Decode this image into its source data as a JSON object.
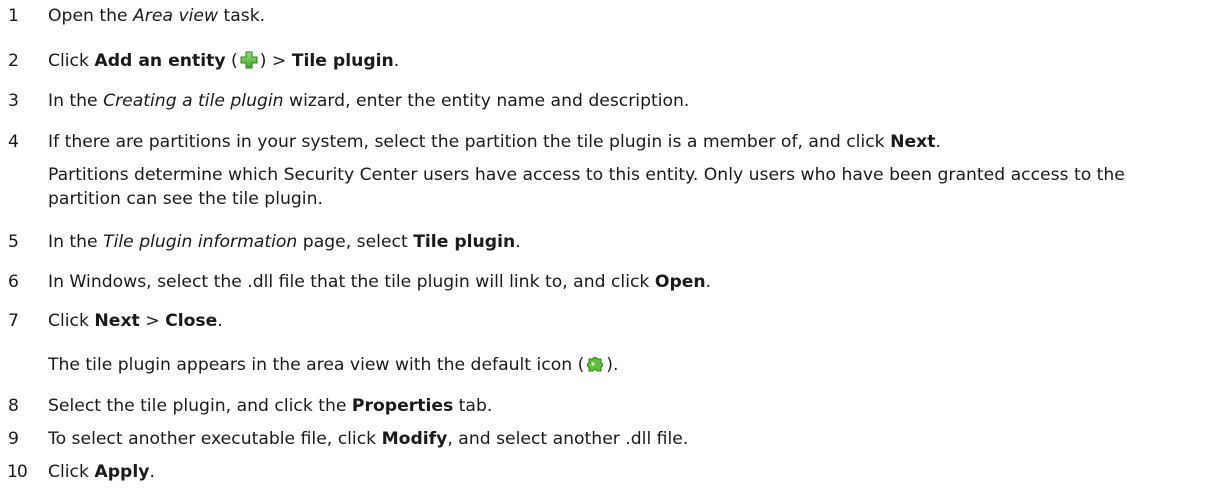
{
  "steps": [
    {
      "num": "1",
      "a": "Open the ",
      "b_italic": "Area view",
      "c": " task."
    },
    {
      "num": "2",
      "a": "Click ",
      "b_bold": "Add an entity",
      "c": " (",
      "icon": "add-entity-icon",
      "d": ") > ",
      "e_bold": "Tile plugin",
      "f": "."
    },
    {
      "num": "3",
      "a": "In the ",
      "b_italic": "Creating a tile plugin",
      "c": " wizard, enter the entity name and description."
    },
    {
      "num": "4",
      "a": "If there are partitions in your system, select the partition the tile plugin is a member of, and click ",
      "b_bold": "Next",
      "c": ".",
      "note": "Partitions determine which Security Center users have access to this entity. Only users who have been granted access to the partition can see the tile plugin."
    },
    {
      "num": "5",
      "a": "In the ",
      "b_italic": "Tile plugin information",
      "c": " page, select ",
      "d_bold": "Tile plugin",
      "e": "."
    },
    {
      "num": "6",
      "a": "In Windows, select the .dll file that the tile plugin will link to, and click ",
      "b_bold": "Open",
      "c": "."
    },
    {
      "num": "7",
      "a": "Click ",
      "b_bold": "Next",
      "c": " > ",
      "d_bold": "Close",
      "e": ".",
      "result_a": "The tile plugin appears in the area view with the default icon (",
      "result_icon": "tile-plugin-puzzle-icon",
      "result_b": ")."
    },
    {
      "num": "8",
      "a": "Select the tile plugin, and click the ",
      "b_bold": "Properties",
      "c": " tab."
    },
    {
      "num": "9",
      "a": "To select another executable file, click ",
      "b_bold": "Modify",
      "c": ", and select another .dll file."
    },
    {
      "num": "10",
      "a": "Click ",
      "b_bold": "Apply",
      "c": "."
    }
  ]
}
